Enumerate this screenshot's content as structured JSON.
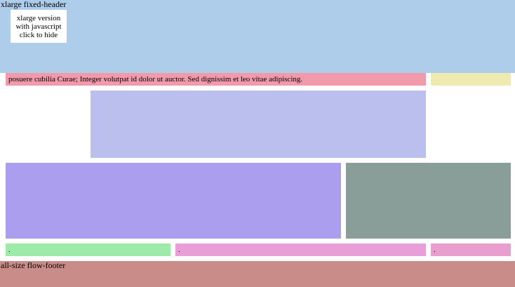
{
  "header": {
    "label": "xlarge fixed-header",
    "toggle": {
      "line1": "xlarge version",
      "line2": "with javascript",
      "line3": "click to hide"
    }
  },
  "row1": {
    "text": "posuere cubilia Curae; Integer volutpat id dolor ut auctor. Sed dignissim et leo vitae adipiscing."
  },
  "small_blocks": {
    "green_text": ".",
    "pink1_text": ".",
    "pink2_text": "."
  },
  "footer": {
    "label": "all-size flow-footer"
  },
  "colors": {
    "header": "#aecdeb",
    "pink_text_block": "#f09aab",
    "yellow": "#eeeab0",
    "lavender": "#babfee",
    "purple": "#ab9eef",
    "gray": "#899d99",
    "green": "#9deaa9",
    "pink": "#ea9ed8",
    "pink_alt": "#ea9dcf",
    "footer": "#c98c88"
  }
}
